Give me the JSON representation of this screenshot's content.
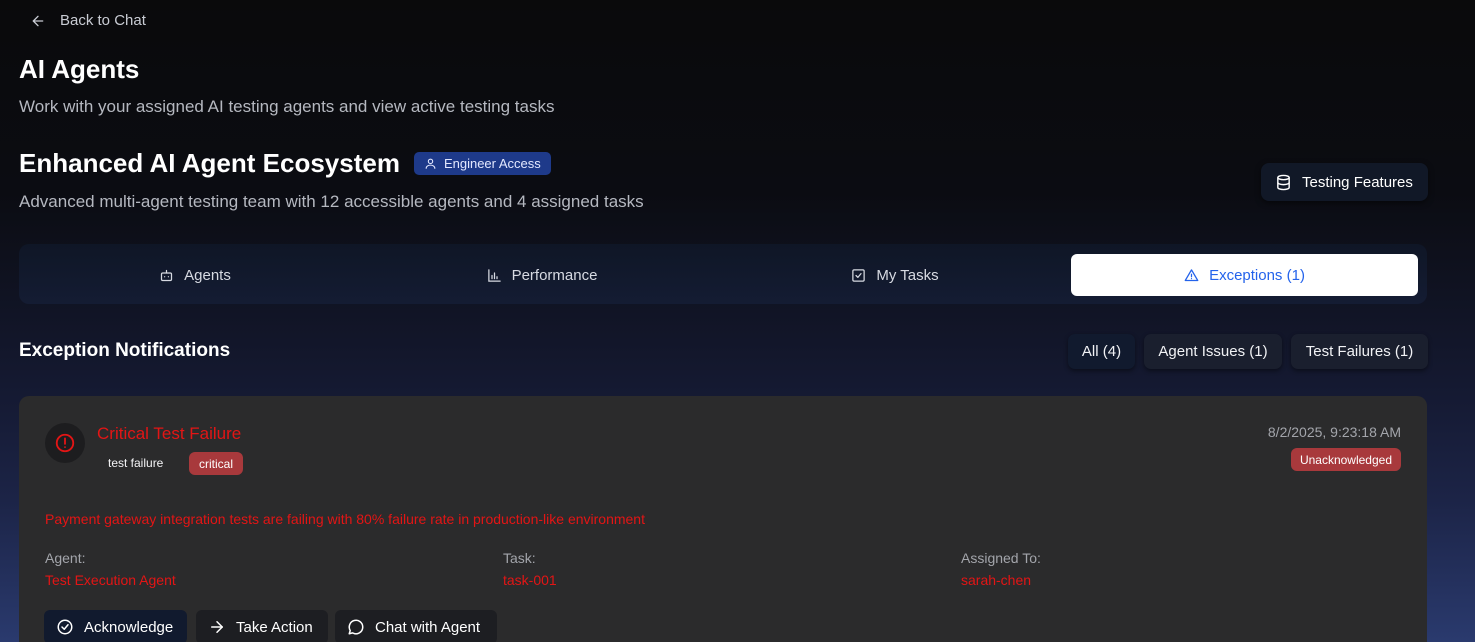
{
  "nav": {
    "back_label": "Back to Chat"
  },
  "header": {
    "title": "AI Agents",
    "subtitle": "Work with your assigned AI testing agents and view active testing tasks"
  },
  "ecosystem": {
    "title": "Enhanced AI Agent Ecosystem",
    "access_badge": "Engineer Access",
    "subtitle": "Advanced multi-agent testing team with 12 accessible agents and 4 assigned tasks",
    "testing_features_label": "Testing Features"
  },
  "tabs": [
    {
      "label": "Agents",
      "icon": "bot-icon",
      "active": false
    },
    {
      "label": "Performance",
      "icon": "bar-chart-icon",
      "active": false
    },
    {
      "label": "My Tasks",
      "icon": "check-square-icon",
      "active": false
    },
    {
      "label": "Exceptions (1)",
      "icon": "alert-triangle-icon",
      "active": true
    }
  ],
  "exceptions": {
    "section_title": "Exception Notifications",
    "filters": [
      {
        "label": "All (4)",
        "active": true
      },
      {
        "label": "Agent Issues (1)",
        "active": false
      },
      {
        "label": "Test Failures (1)",
        "active": false
      }
    ],
    "items": [
      {
        "title": "Critical Test Failure",
        "type": "test failure",
        "severity": "critical",
        "timestamp": "8/2/2025, 9:23:18 AM",
        "status": "Unacknowledged",
        "message": "Payment gateway integration tests are failing with 80% failure rate in production-like environment",
        "agent_label": "Agent:",
        "agent": "Test Execution Agent",
        "task_label": "Task:",
        "task": "task-001",
        "assigned_label": "Assigned To:",
        "assigned": "sarah-chen",
        "actions": {
          "acknowledge": "Acknowledge",
          "take_action": "Take Action",
          "chat": "Chat with Agent"
        }
      }
    ]
  },
  "colors": {
    "accent_blue": "#2463eb",
    "badge_blue": "#1e3a8a",
    "critical_red": "#e31515",
    "badge_red": "#a8393c"
  }
}
